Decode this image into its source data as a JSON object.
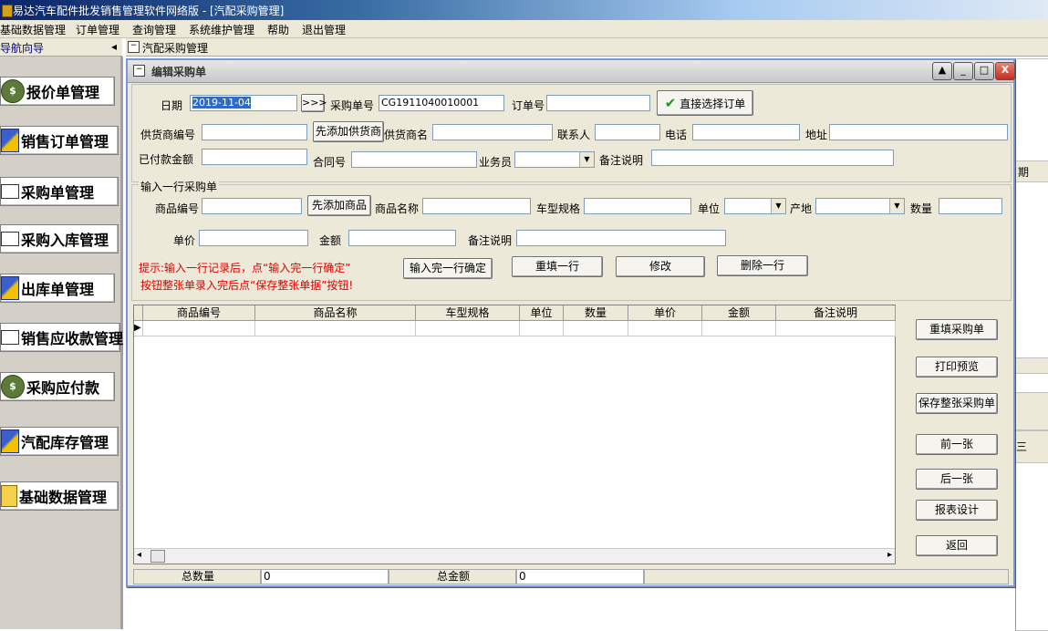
{
  "window": {
    "title": "易达汽车配件批发销售管理软件网络版 - [汽配采购管理]"
  },
  "menu": [
    "基础数据管理",
    "订单管理",
    "查询管理",
    "系统维护管理",
    "帮助",
    "退出管理"
  ],
  "nav": {
    "header": "导航向导",
    "collapse_glyph": "◂",
    "items": [
      {
        "label": "报价单管理",
        "icon": "money-bag-icon"
      },
      {
        "label": "销售订单管理",
        "icon": "pen-icon"
      },
      {
        "label": "采购单管理",
        "icon": "card-icon"
      },
      {
        "label": "采购入库管理",
        "icon": "card-icon"
      },
      {
        "label": "出库单管理",
        "icon": "pen-icon"
      },
      {
        "label": "销售应收款管理",
        "icon": "card-icon"
      },
      {
        "label": "采购应付款",
        "icon": "money-bag-icon"
      },
      {
        "label": "汽配库存管理",
        "icon": "pen-icon"
      },
      {
        "label": "基础数据管理",
        "icon": "document-icon"
      }
    ]
  },
  "background_form": {
    "title": "汽配采购管理",
    "col_header": "期",
    "partial_text": "三"
  },
  "edit_window": {
    "title": "编辑采购单",
    "header": {
      "date_label": "日期",
      "date_value": "2019-11-04",
      "date_picker_label": ">>>",
      "po_no_label": "采购单号",
      "po_no_value": "CG1911040010001",
      "order_no_label": "订单号",
      "order_no_value": "",
      "select_order_button": "直接选择订单",
      "supplier_code_label": "供货商编号",
      "add_supplier_button": "先添加供货商",
      "supplier_name_label": "供货商名",
      "contact_label": "联系人",
      "phone_label": "电话",
      "address_label": "地址",
      "paid_label": "已付款金额",
      "contract_label": "合同号",
      "salesman_label": "业务员",
      "remark_label": "备注说明"
    },
    "line_entry": {
      "group_title": "输入一行采购单",
      "item_code_label": "商品编号",
      "add_item_button": "先添加商品",
      "item_name_label": "商品名称",
      "model_label": "车型规格",
      "unit_label": "单位",
      "origin_label": "产地",
      "qty_label": "数量",
      "price_label": "单价",
      "amount_label": "金额",
      "remark_label": "备注说明",
      "hint_line1": "提示:输入一行记录后，点“输入完一行确定”",
      "hint_line2": "按钮整张单录入完后点“保存整张单据”按钮!",
      "confirm_button": "输入完一行确定",
      "refill_row_button": "重填一行",
      "modify_button": "修改",
      "delete_row_button": "删除一行"
    },
    "grid": {
      "columns": [
        "商品编号",
        "商品名称",
        "车型规格",
        "单位",
        "数量",
        "单价",
        "金额",
        "备注说明"
      ],
      "row_indicator": "▶",
      "scroll_left": "◂",
      "scroll_right": "▸"
    },
    "side_buttons": [
      "重填采购单",
      "打印预览",
      "保存整张采购单",
      "前一张",
      "后一张",
      "报表设计",
      "返回"
    ],
    "status": {
      "total_qty_label": "总数量",
      "total_qty_value": "0",
      "total_amount_label": "总金额",
      "total_amount_value": "0"
    },
    "caption_buttons": {
      "up": "▲",
      "min": "_",
      "max": "□",
      "close": "X"
    }
  }
}
